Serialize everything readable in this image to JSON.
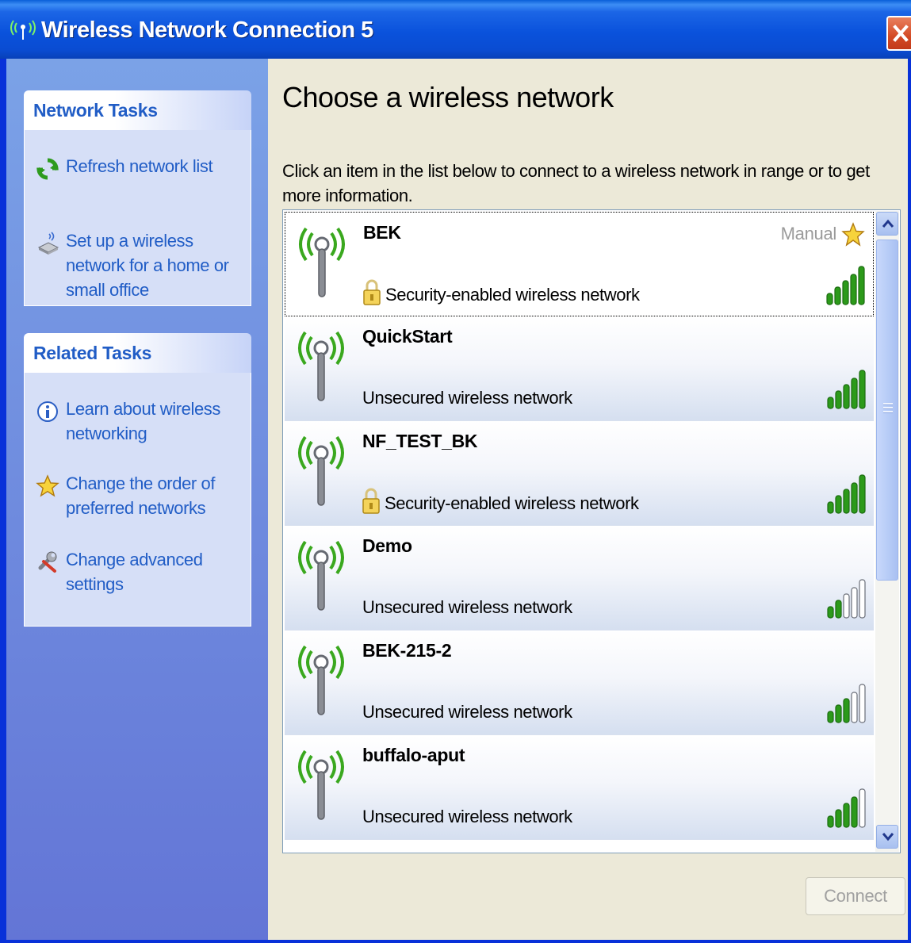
{
  "window": {
    "title": "Wireless Network Connection 5",
    "title_icon": "wireless-signal-icon",
    "close_icon": "close-icon"
  },
  "taskpane": {
    "network_tasks": {
      "header": "Network Tasks",
      "items": [
        {
          "label": "Refresh network list",
          "icon": "refresh-icon"
        },
        {
          "label": "Set up a wireless network for a home or small office",
          "icon": "wireless-setup-icon"
        }
      ]
    },
    "related_tasks": {
      "header": "Related Tasks",
      "items": [
        {
          "label": "Learn about wireless networking",
          "icon": "info-icon"
        },
        {
          "label": "Change the order of preferred networks",
          "icon": "star-icon"
        },
        {
          "label": "Change advanced settings",
          "icon": "settings-icon"
        }
      ]
    }
  },
  "main": {
    "heading": "Choose a wireless network",
    "instructions": "Click an item in the list below to connect to a wireless network in range or to get more information.",
    "connect_label": "Connect"
  },
  "networks": [
    {
      "name": "BEK",
      "status": "Security-enabled wireless network",
      "secured": true,
      "badge": "Manual",
      "signal_bars": 5
    },
    {
      "name": "QuickStart",
      "status": "Unsecured wireless network",
      "secured": false,
      "signal_bars": 5
    },
    {
      "name": "NF_TEST_BK",
      "status": "Security-enabled wireless network",
      "secured": true,
      "signal_bars": 5
    },
    {
      "name": "Demo",
      "status": "Unsecured wireless network",
      "secured": false,
      "signal_bars": 2
    },
    {
      "name": "BEK-215-2",
      "status": "Unsecured wireless network",
      "secured": false,
      "signal_bars": 3
    },
    {
      "name": "buffalo-aput",
      "status": "Unsecured wireless network",
      "secured": false,
      "signal_bars": 4
    }
  ],
  "colors": {
    "titlebar": "#0a52dc",
    "taskpane": "#6375d6",
    "link": "#215dc6",
    "signal_on": "#2c9a1a",
    "signal_off": "#ffffff"
  }
}
